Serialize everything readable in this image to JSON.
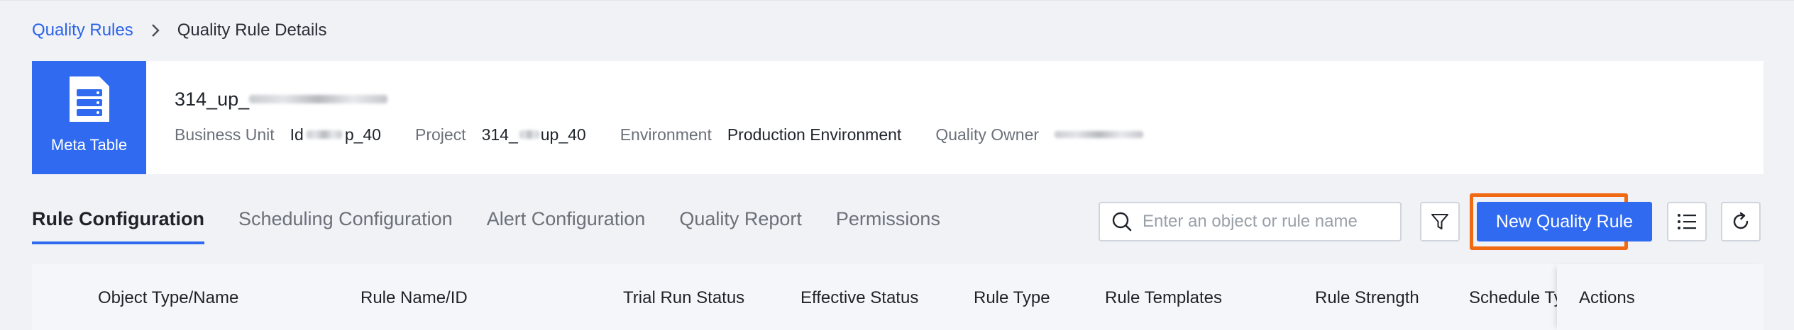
{
  "breadcrumb": {
    "parent": "Quality Rules",
    "current": "Quality Rule Details"
  },
  "header": {
    "tile_label": "Meta Table",
    "tile_icon": "table-list-icon",
    "object_name_prefix": "314_up_",
    "business_unit_key": "Business Unit",
    "business_unit_val_prefix": "Id",
    "business_unit_val_suffix": "p_40",
    "project_key": "Project",
    "project_val_prefix": "314_",
    "project_val_suffix": "up_40",
    "environment_key": "Environment",
    "environment_val": "Production Environment",
    "owner_key": "Quality Owner"
  },
  "tabs": [
    {
      "label": "Rule Configuration",
      "active": true
    },
    {
      "label": "Scheduling Configuration",
      "active": false
    },
    {
      "label": "Alert Configuration",
      "active": false
    },
    {
      "label": "Quality Report",
      "active": false
    },
    {
      "label": "Permissions",
      "active": false
    }
  ],
  "toolbar": {
    "search_placeholder": "Enter an object or rule name",
    "new_rule_label": "New Quality Rule",
    "filter_icon": "filter-icon",
    "list_icon": "list-icon",
    "refresh_icon": "refresh-icon"
  },
  "table": {
    "columns": [
      "Object Type/Name",
      "Rule Name/ID",
      "Trial Run Status",
      "Effective Status",
      "Rule Type",
      "Rule Templates",
      "Rule Strength",
      "Schedule Type",
      "Actions"
    ]
  },
  "colors": {
    "accent": "#2f6af0",
    "link": "#2b63e8",
    "highlight": "#f06a14"
  }
}
